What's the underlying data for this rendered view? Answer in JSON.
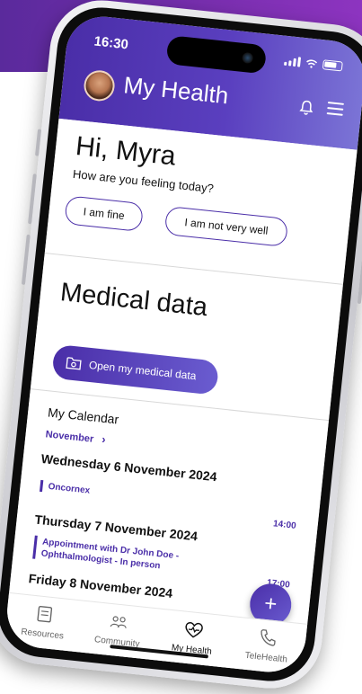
{
  "status_bar": {
    "time": "16:30"
  },
  "header": {
    "title": "My Health"
  },
  "greeting": {
    "hello": "Hi, Myra",
    "question": "How are you feeling today?",
    "option_fine": "I am fine",
    "option_unwell": "I am not very well"
  },
  "medical": {
    "title": "Medical data",
    "button": "Open my medical data"
  },
  "calendar": {
    "title": "My Calendar",
    "month": "November",
    "days": [
      {
        "label": "Wednesday 6 November 2024",
        "event": "Oncornex",
        "time": "14:00"
      },
      {
        "label": "Thursday 7 November 2024",
        "event_line1": "Appointment with Dr John Doe -",
        "event_line2": "Ophthalmologist - In person",
        "time": "17:00"
      },
      {
        "label": "Friday 8 November 2024"
      }
    ]
  },
  "fab": {
    "symbol": "+"
  },
  "tabs": [
    {
      "label": "Resources",
      "icon": "document-icon"
    },
    {
      "label": "Community",
      "icon": "people-icon"
    },
    {
      "label": "My Health",
      "icon": "heart-pulse-icon"
    },
    {
      "label": "TeleHealth",
      "icon": "phone-icon"
    }
  ],
  "colors": {
    "primary": "#4a2ea8",
    "accent": "#6a5cd0",
    "backdrop": "#7a2fb0"
  }
}
